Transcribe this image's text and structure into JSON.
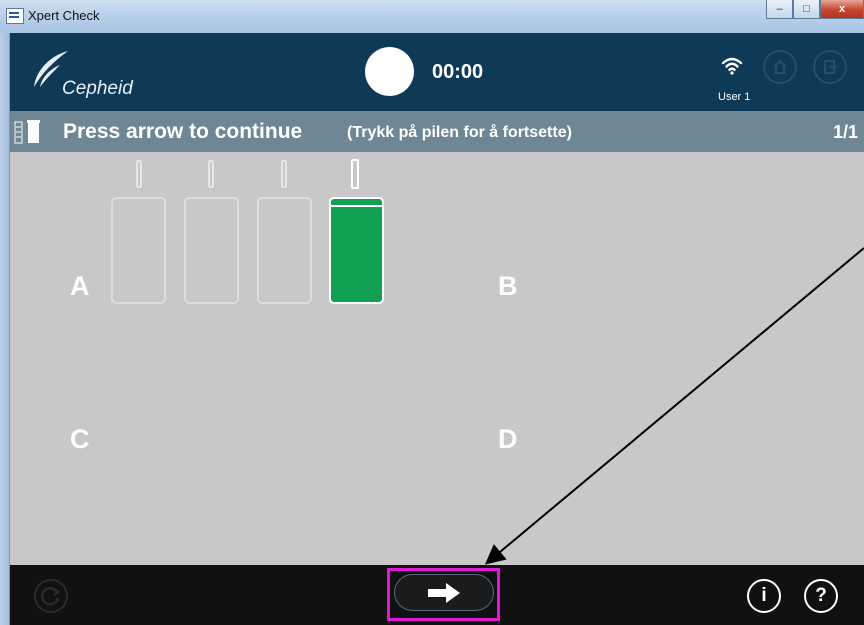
{
  "window": {
    "title": "Xpert Check",
    "minimize_glyph": "–",
    "maximize_glyph": "□",
    "close_glyph": "x"
  },
  "header": {
    "brand": "Cepheid",
    "timer": "00:00",
    "user": "User 1",
    "icons": [
      "cepheid-logo-icon",
      "wifi-icon",
      "home-icon",
      "exit-icon"
    ]
  },
  "instruction": {
    "text": "Press arrow to continue",
    "translation": "(Trykk på pilen for å fortsette)",
    "page": "1/1"
  },
  "main": {
    "quadrants": [
      "A",
      "B",
      "C",
      "D"
    ],
    "modules": [
      "empty",
      "empty",
      "empty",
      "active"
    ]
  },
  "footer": {
    "info_glyph": "i",
    "help_glyph": "?",
    "icons": [
      "refresh-icon",
      "arrow-right-icon",
      "info-icon",
      "help-icon"
    ]
  },
  "colors": {
    "header_bg": "#0f3a57",
    "instruction_bg": "#6f8795",
    "main_bg": "#c8c8c8",
    "active_module": "#12a154",
    "footer_bg": "#111111",
    "highlight": "#e21ad7"
  }
}
